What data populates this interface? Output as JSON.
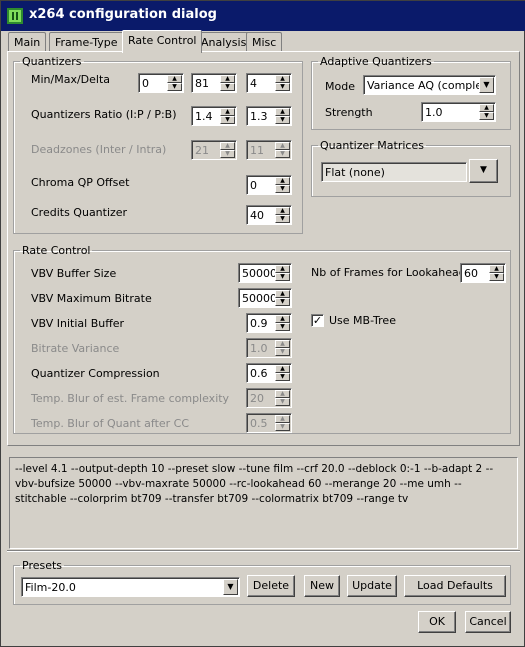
{
  "window": {
    "title": "x264 configuration dialog",
    "icon": "x264-app-icon"
  },
  "tabs": [
    {
      "label": "Main",
      "active": false
    },
    {
      "label": "Frame-Type",
      "active": false
    },
    {
      "label": "Rate Control",
      "active": true
    },
    {
      "label": "Analysis",
      "active": false
    },
    {
      "label": "Misc",
      "active": false
    }
  ],
  "quantizers": {
    "title": "Quantizers",
    "min_max_delta": {
      "label": "Min/Max/Delta",
      "min": "0",
      "max": "81",
      "delta": "4"
    },
    "ratio": {
      "label": "Quantizers Ratio (I:P / P:B)",
      "ip": "1.4",
      "pb": "1.3"
    },
    "deadzones": {
      "label": "Deadzones (Inter / Intra)",
      "inter": "21",
      "intra": "11",
      "enabled": false
    },
    "chroma_qp": {
      "label": "Chroma QP Offset",
      "value": "0"
    },
    "credits": {
      "label": "Credits Quantizer",
      "value": "40"
    }
  },
  "adaptive_quantizers": {
    "title": "Adaptive Quantizers",
    "mode_label": "Mode",
    "mode_value": "Variance AQ (complexit",
    "strength_label": "Strength",
    "strength_value": "1.0"
  },
  "quantizer_matrices": {
    "title": "Quantizer Matrices",
    "value": "Flat (none)"
  },
  "rate_control": {
    "title": "Rate Control",
    "vbv_buffer_size": {
      "label": "VBV Buffer Size",
      "value": "50000"
    },
    "vbv_max_bitrate": {
      "label": "VBV Maximum Bitrate",
      "value": "50000"
    },
    "vbv_initial_buffer": {
      "label": "VBV Initial Buffer",
      "value": "0.9"
    },
    "bitrate_variance": {
      "label": "Bitrate Variance",
      "value": "1.0",
      "enabled": false
    },
    "quantizer_compression": {
      "label": "Quantizer Compression",
      "value": "0.6"
    },
    "temp_blur_complexity": {
      "label": "Temp. Blur of est. Frame complexity",
      "value": "20",
      "enabled": false
    },
    "temp_blur_quant": {
      "label": "Temp. Blur of Quant after CC",
      "value": "0.5",
      "enabled": false
    },
    "lookahead": {
      "label": "Nb of Frames for Lookahead",
      "value": "60"
    },
    "mb_tree": {
      "label": "Use MB-Tree",
      "checked": true,
      "mark": "✓"
    }
  },
  "command_line": "--level 4.1 --output-depth 10 --preset slow --tune film --crf 20.0 --deblock 0:-1 --b-adapt 2 --vbv-bufsize 50000 --vbv-maxrate 50000 --rc-lookahead 60 --merange 20 --me umh --stitchable --colorprim bt709 --transfer bt709 --colormatrix bt709 --range tv",
  "presets": {
    "title": "Presets",
    "selected": "Film-20.0",
    "buttons": {
      "delete": "Delete",
      "new": "New",
      "update": "Update",
      "load_defaults": "Load Defaults"
    }
  },
  "dialog_buttons": {
    "ok": "OK",
    "cancel": "Cancel"
  },
  "arrows": {
    "up": "▲",
    "down": "▼"
  }
}
